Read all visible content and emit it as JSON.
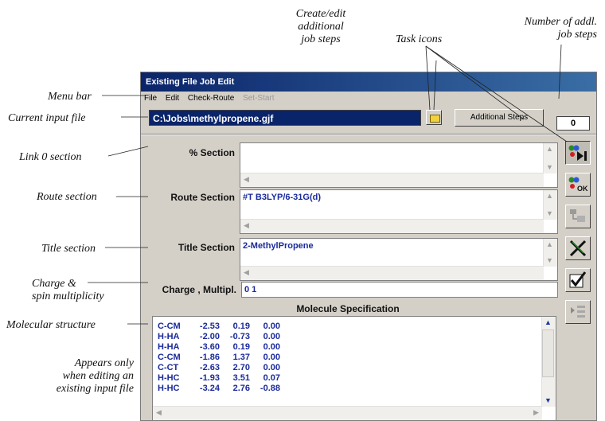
{
  "annotations": {
    "create_edit": [
      "Create/edit",
      "additional",
      "job steps"
    ],
    "task_icons": "Task icons",
    "number_steps": [
      "Number of addl.",
      "job steps"
    ],
    "menu_bar": "Menu bar",
    "current_input": "Current input file",
    "link0": "Link 0 section",
    "route": "Route section",
    "title": "Title section",
    "charge": [
      "Charge &",
      "spin multiplicity"
    ],
    "molecular": "Molecular structure",
    "appears": [
      "Appears only",
      "when editing an",
      "existing input file"
    ]
  },
  "window": {
    "title": "Existing File Job Edit",
    "menu": [
      "File",
      "Edit",
      "Check-Route",
      "Set-Start"
    ],
    "menu_disabled_index": 3,
    "input_file": "C:\\Jobs\\methylpropene.gjf",
    "additional_steps_label": "Additional Steps",
    "step_count": "0",
    "sections": {
      "percent": {
        "label": "% Section",
        "value": ""
      },
      "route": {
        "label": "Route Section",
        "value": "#T B3LYP/6-31G(d)"
      },
      "title": {
        "label": "Title Section",
        "value": "2-MethylPropene"
      }
    },
    "charge": {
      "label": "Charge , Multipl.",
      "value": "0 1"
    },
    "molecule": {
      "header": "Molecule Specification",
      "rows": [
        [
          "C-CM",
          "-2.53",
          "0.19",
          "0.00"
        ],
        [
          "H-HA",
          "-2.00",
          "-0.73",
          "0.00"
        ],
        [
          "H-HA",
          "-3.60",
          "0.19",
          "0.00"
        ],
        [
          "C-CM",
          "-1.86",
          "1.37",
          "0.00"
        ],
        [
          "C-CT",
          "-2.63",
          "2.70",
          "0.00"
        ],
        [
          "H-HC",
          "-1.93",
          "3.51",
          "0.07"
        ],
        [
          "H-HC",
          "-3.24",
          "2.76",
          "-0.88"
        ]
      ]
    }
  },
  "colors": {
    "titlebar": "#0a246a",
    "text_blue": "#1a2a9a",
    "window_bg": "#d4d0c8"
  },
  "toolbar_icons": [
    "run-job-icon",
    "route-ok-icon",
    "steps-icon",
    "cancel-icon",
    "check-icon",
    "list-icon"
  ]
}
